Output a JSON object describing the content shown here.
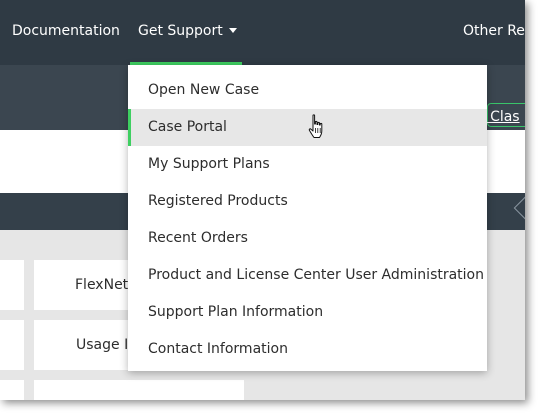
{
  "nav": {
    "documentation": "Documentation",
    "get_support": "Get Support",
    "other_resources": "Other Re"
  },
  "band": {
    "link": "e Clas"
  },
  "menu": {
    "items": [
      {
        "label": "Open New Case"
      },
      {
        "label": "Case Portal",
        "active": true
      },
      {
        "label": "My Support Plans"
      },
      {
        "label": "Registered Products"
      },
      {
        "label": "Recent Orders"
      },
      {
        "label": "Product and License Center User Administration"
      },
      {
        "label": "Support Plan Information"
      },
      {
        "label": "Contact Information"
      }
    ]
  },
  "tiles": {
    "row1": "FlexNet",
    "row2": "Usage I"
  },
  "colors": {
    "nav_bg": "#2f3a44",
    "accent_green": "#3ecf61",
    "band_bg": "#3b4650",
    "hover_bg": "#e7e7e7"
  },
  "icons": {
    "caret": "chevron-down-icon",
    "cursor": "hand-pointer-cursor-icon"
  }
}
